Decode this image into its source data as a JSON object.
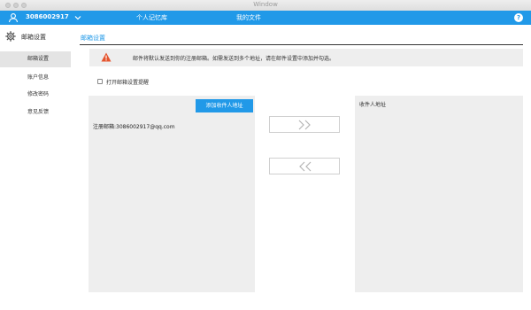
{
  "window": {
    "title": "Window"
  },
  "topbar": {
    "username": "3086002917",
    "nav": {
      "memory": "个人记忆库",
      "files": "我的文件"
    },
    "help_label": "?"
  },
  "sidebar": {
    "title": "邮箱设置",
    "items": [
      {
        "label": "邮箱设置",
        "active": true
      },
      {
        "label": "账户信息",
        "active": false
      },
      {
        "label": "修改密码",
        "active": false
      },
      {
        "label": "意见反馈",
        "active": false
      }
    ]
  },
  "main": {
    "title": "邮箱设置",
    "notice": "邮件将默认发送到你的注册邮箱。如需发送到多个地址，请在邮件设置中添加并勾选。",
    "reminder_label": "打开邮箱设置提醒",
    "reminder_checked": false,
    "left_panel": {
      "add_button_label": "添加收件人地址",
      "registered_email": "注册邮箱:3086002917@qq.com"
    },
    "right_panel": {
      "title": "收件人地址"
    }
  },
  "colors": {
    "accent": "#2199e8",
    "panel_bg": "#eeeeee",
    "warning": "#e5542d"
  },
  "icons": {
    "user": "user-icon",
    "caret": "chevron-down-icon",
    "help": "help-icon",
    "gear": "gear-icon",
    "warning": "warning-icon",
    "move_right": "double-chevron-right-icon",
    "move_left": "double-chevron-left-icon"
  }
}
